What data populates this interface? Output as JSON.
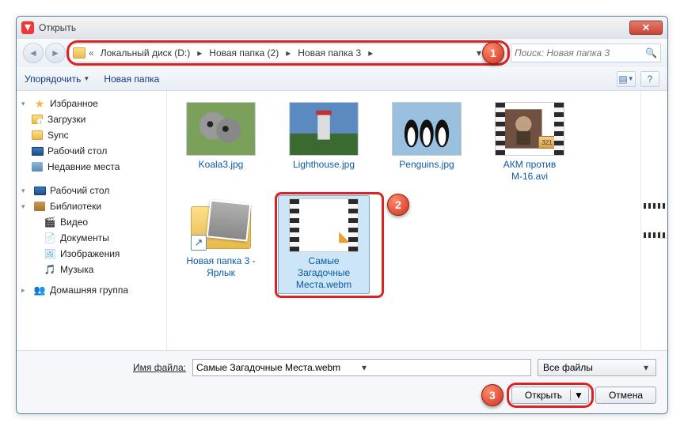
{
  "window": {
    "title": "Открыть"
  },
  "breadcrumb": {
    "segments": [
      "Локальный диск (D:)",
      "Новая папка (2)",
      "Новая папка 3"
    ],
    "prefix": "«"
  },
  "search": {
    "placeholder": "Поиск: Новая папка 3"
  },
  "toolbar": {
    "organize": "Упорядочить",
    "newfolder": "Новая папка"
  },
  "sidebar": {
    "favorites": {
      "label": "Избранное",
      "items": [
        "Загрузки",
        "Sync",
        "Рабочий стол",
        "Недавние места"
      ]
    },
    "desktop": {
      "label": "Рабочий стол"
    },
    "libraries": {
      "label": "Библиотеки",
      "items": [
        "Видео",
        "Документы",
        "Изображения",
        "Музыка"
      ]
    },
    "homegroup": {
      "label": "Домашняя группа"
    }
  },
  "files": [
    {
      "name": "Koala3.jpg",
      "kind": "image"
    },
    {
      "name": "Lighthouse.jpg",
      "kind": "image"
    },
    {
      "name": "Penguins.jpg",
      "kind": "image"
    },
    {
      "name": "АКМ против М-16.avi",
      "kind": "video-mpc"
    },
    {
      "name": "Новая папка 3 - Ярлык",
      "kind": "folder-shortcut"
    },
    {
      "name": "Самые Загадочные Места.webm",
      "kind": "video",
      "selected": true
    }
  ],
  "footer": {
    "filename_label": "Имя файла:",
    "filename_value": "Самые Загадочные Места.webm",
    "filter": "Все файлы",
    "open": "Открыть",
    "cancel": "Отмена"
  },
  "annotations": {
    "c1": "1",
    "c2": "2",
    "c3": "3"
  },
  "mpc_badge": "321"
}
